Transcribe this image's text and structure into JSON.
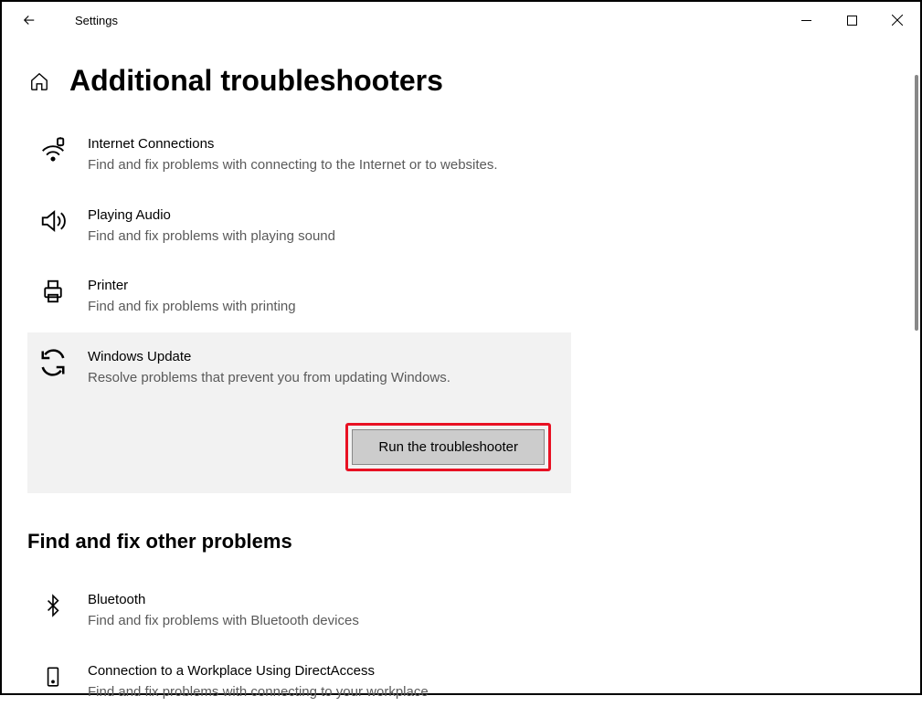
{
  "window": {
    "title": "Settings"
  },
  "page": {
    "title": "Additional troubleshooters"
  },
  "troubleshooters": [
    {
      "title": "Internet Connections",
      "desc": "Find and fix problems with connecting to the Internet or to websites."
    },
    {
      "title": "Playing Audio",
      "desc": "Find and fix problems with playing sound"
    },
    {
      "title": "Printer",
      "desc": "Find and fix problems with printing"
    },
    {
      "title": "Windows Update",
      "desc": "Resolve problems that prevent you from updating Windows."
    }
  ],
  "actions": {
    "run": "Run the troubleshooter"
  },
  "section2": {
    "heading": "Find and fix other problems"
  },
  "other_troubleshooters": [
    {
      "title": "Bluetooth",
      "desc": "Find and fix problems with Bluetooth devices"
    },
    {
      "title": "Connection to a Workplace Using DirectAccess",
      "desc": "Find and fix problems with connecting to your workplace"
    }
  ]
}
